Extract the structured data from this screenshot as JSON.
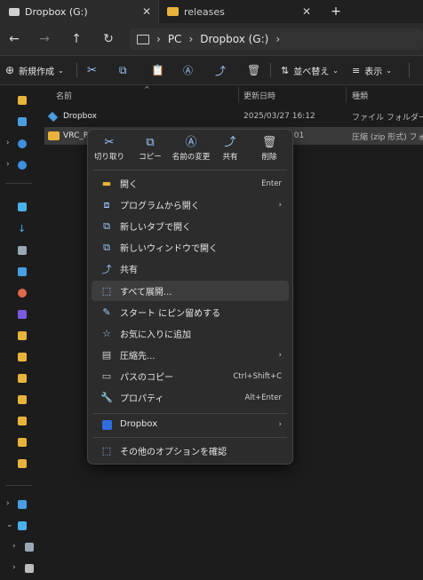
{
  "tabs": [
    {
      "label": "Dropbox (G:)",
      "close": "✕"
    },
    {
      "label": "releases",
      "close": "✕"
    }
  ],
  "new_tab": "+",
  "address": {
    "pc": "PC",
    "location": "Dropbox (G:)"
  },
  "toolbar": {
    "new_label": "新規作成",
    "sort_label": "並べ替え",
    "view_label": "表示"
  },
  "columns": {
    "name": "名前",
    "modified": "更新日時",
    "type": "種類"
  },
  "files": [
    {
      "name": "Dropbox",
      "modified": "2025/03/27 16:12",
      "type": "ファイル フォルダー"
    },
    {
      "name": "VRC_Ple",
      "modified": "9:01",
      "type": "圧縮 (zip 形式) フォル"
    }
  ],
  "context_menu": {
    "quick_actions": [
      {
        "label": "切り取り",
        "icon": "scissors-icon"
      },
      {
        "label": "コピー",
        "icon": "copy-icon"
      },
      {
        "label": "名前の変更",
        "icon": "rename-icon"
      },
      {
        "label": "共有",
        "icon": "share-icon"
      },
      {
        "label": "削除",
        "icon": "trash-icon"
      }
    ],
    "items": [
      {
        "label": "開く",
        "shortcut": "Enter",
        "icon": "folder-open-icon",
        "submenu": false
      },
      {
        "label": "プログラムから開く",
        "shortcut": "",
        "icon": "open-with-icon",
        "submenu": true
      },
      {
        "label": "新しいタブで開く",
        "shortcut": "",
        "icon": "new-tab-icon",
        "submenu": false
      },
      {
        "label": "新しいウィンドウで開く",
        "shortcut": "",
        "icon": "new-window-icon",
        "submenu": false
      },
      {
        "label": "共有",
        "shortcut": "",
        "icon": "share-icon",
        "submenu": false
      },
      {
        "label": "すべて展開...",
        "shortcut": "",
        "icon": "extract-icon",
        "submenu": false,
        "highlighted": true
      },
      {
        "label": "スタート にピン留めする",
        "shortcut": "",
        "icon": "pin-icon",
        "submenu": false
      },
      {
        "label": "お気に入りに追加",
        "shortcut": "",
        "icon": "star-icon",
        "submenu": false
      },
      {
        "label": "圧縮先...",
        "shortcut": "",
        "icon": "compress-icon",
        "submenu": true
      },
      {
        "label": "パスのコピー",
        "shortcut": "Ctrl+Shift+C",
        "icon": "copy-path-icon",
        "submenu": false
      },
      {
        "label": "プロパティ",
        "shortcut": "Alt+Enter",
        "icon": "wrench-icon",
        "submenu": false
      }
    ],
    "dropbox_item": {
      "label": "Dropbox",
      "icon": "dropbox-icon"
    },
    "more_options": {
      "label": "その他のオプションを確認",
      "icon": "more-options-icon"
    }
  }
}
